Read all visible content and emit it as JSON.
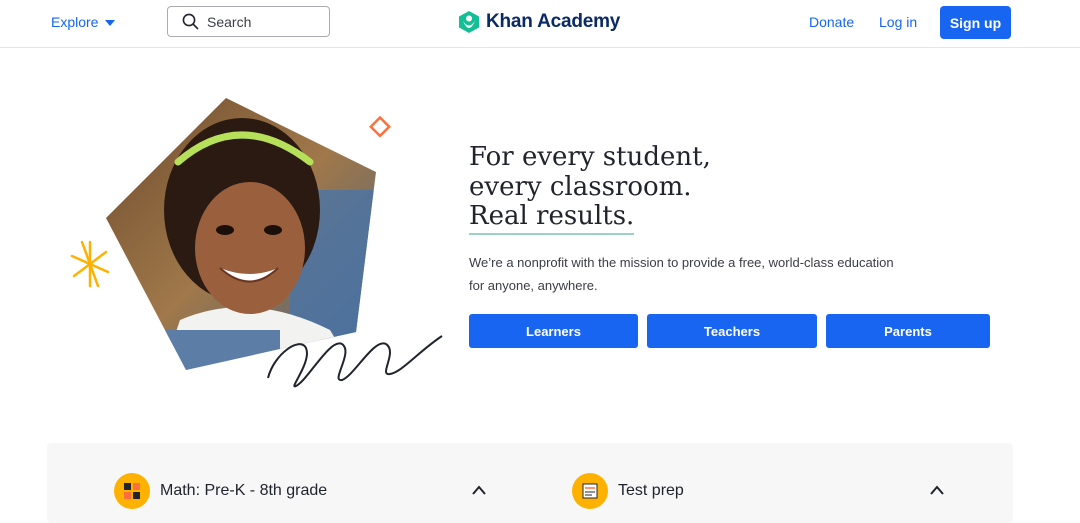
{
  "header": {
    "explore_label": "Explore",
    "search_placeholder": "Search",
    "logo_text": "Khan Academy",
    "donate_label": "Donate",
    "login_label": "Log in",
    "signup_label": "Sign up"
  },
  "hero": {
    "headline": [
      "For every student,",
      "every classroom.",
      "Real results."
    ],
    "subtext": [
      "We’re a nonprofit with the mission to provide a free, world-class education",
      "for anyone, anywhere."
    ],
    "buttons": [
      "Learners",
      "Teachers",
      "Parents"
    ]
  },
  "subjects": [
    {
      "label": "Math: Pre-K - 8th grade",
      "icon": "math-blocks-icon"
    },
    {
      "label": "Test prep",
      "icon": "test-prep-icon"
    }
  ],
  "colors": {
    "primary": "#1865f2",
    "brand_dark": "#0a2a66",
    "logo_green": "#14bf96",
    "accent_orange": "#ff6f3c",
    "accent_yellow": "#ffb100"
  }
}
